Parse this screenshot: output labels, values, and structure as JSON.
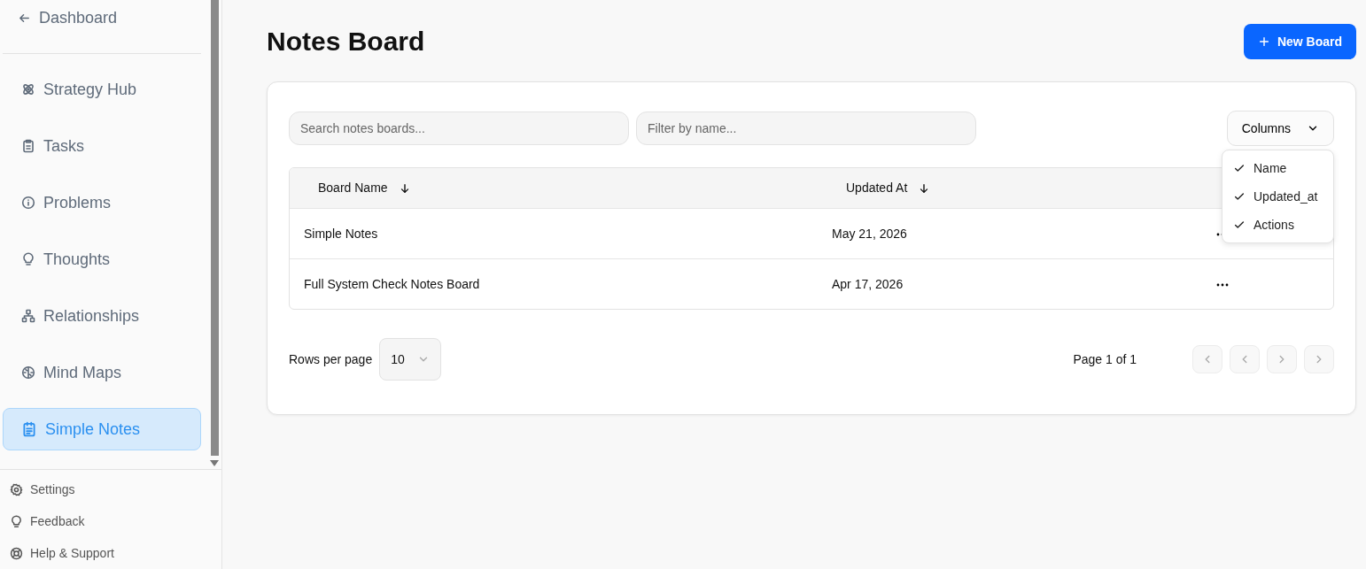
{
  "sidebar": {
    "back": {
      "label": "Dashboard"
    },
    "items": [
      {
        "label": "Strategy Hub",
        "selected": false
      },
      {
        "label": "Tasks",
        "selected": false
      },
      {
        "label": "Problems",
        "selected": false
      },
      {
        "label": "Thoughts",
        "selected": false
      },
      {
        "label": "Relationships",
        "selected": false
      },
      {
        "label": "Mind Maps",
        "selected": false
      },
      {
        "label": "Simple Notes",
        "selected": true
      }
    ],
    "footer": [
      {
        "label": "Settings"
      },
      {
        "label": "Feedback"
      },
      {
        "label": "Help & Support"
      }
    ]
  },
  "page": {
    "title": "Notes Board",
    "new_button": "New Board"
  },
  "filters": {
    "search": {
      "placeholder": "Search notes boards..."
    },
    "name": {
      "placeholder": "Filter by name..."
    }
  },
  "columns_button": {
    "label": "Columns",
    "expanded": true,
    "options": [
      {
        "label": "Name",
        "checked": true
      },
      {
        "label": "Updated_at",
        "checked": true
      },
      {
        "label": "Actions",
        "checked": true
      }
    ]
  },
  "table": {
    "columns": [
      "Board Name",
      "Updated At"
    ],
    "rows": [
      {
        "name": "Simple Notes",
        "updated": "May 21, 2026"
      },
      {
        "name": "Full System Check Notes Board",
        "updated": "Apr 17, 2026"
      }
    ]
  },
  "pagination": {
    "rows_label": "Rows per page",
    "rows_value": "10",
    "page_label": "Page 1 of 1",
    "buttons": [
      {
        "disabled": true
      },
      {
        "disabled": true
      },
      {
        "disabled": true
      },
      {
        "disabled": true
      }
    ]
  }
}
